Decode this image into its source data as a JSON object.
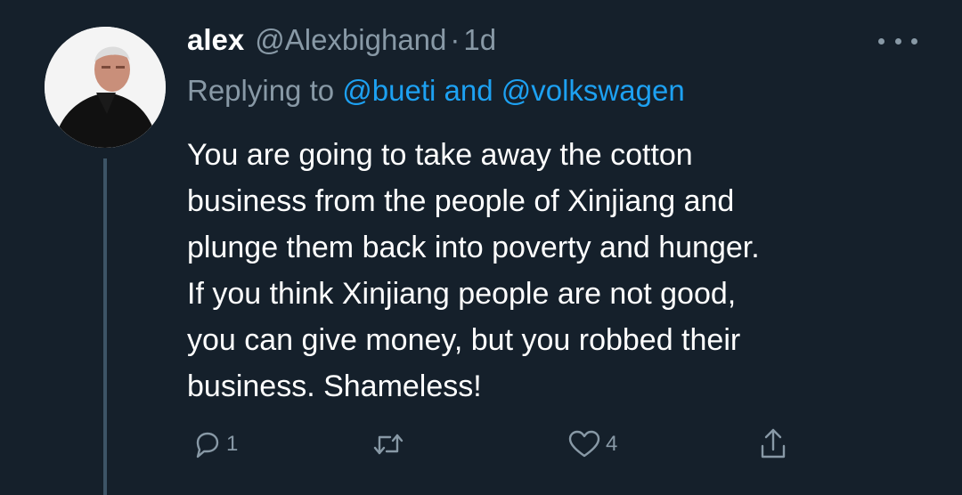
{
  "tweet": {
    "name": "alex",
    "handle": "@Alexbighand",
    "separator": "·",
    "time": "1d",
    "replying_prefix": "Replying to",
    "mention_1": "@bueti",
    "connector": "and",
    "mention_2": "@volkswagen",
    "body_lines": [
      "You are going to take away the cotton",
      "business from the people of Xinjiang and",
      "plunge them back into poverty and hunger.",
      "If you think Xinjiang people are not good,",
      "you can give money, but you robbed their",
      "business. Shameless!"
    ]
  },
  "actions": {
    "reply_icon": "reply-icon",
    "reply_count": "1",
    "retweet_icon": "retweet-icon",
    "like_icon": "heart-icon",
    "like_count": "4",
    "share_icon": "share-icon"
  },
  "colors": {
    "background": "#15202b",
    "text": "#ffffff",
    "secondary": "#8899a6",
    "link": "#1da1f2"
  }
}
